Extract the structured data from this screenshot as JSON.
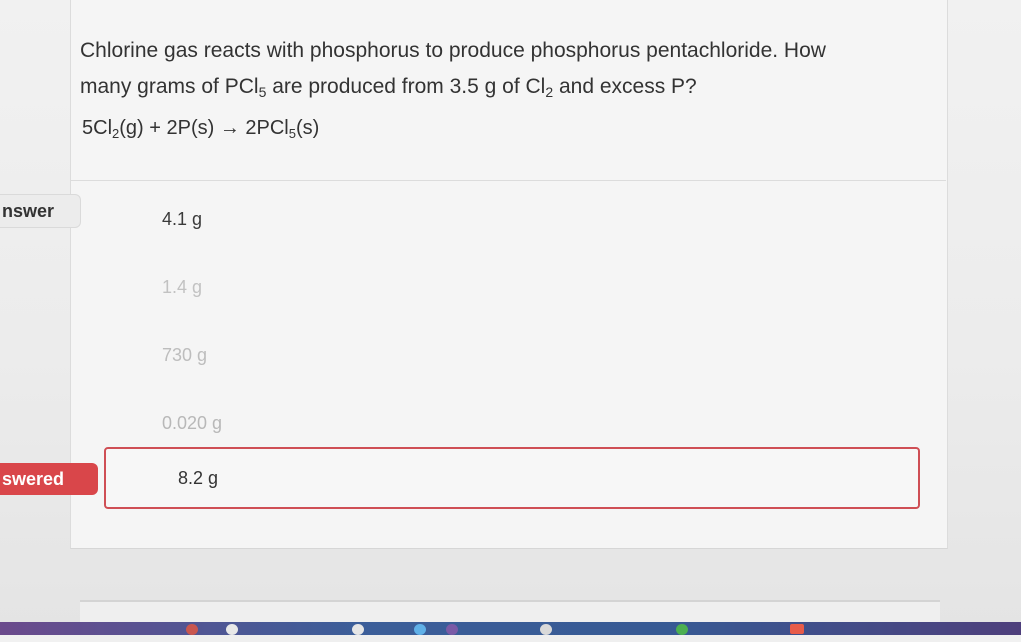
{
  "question": {
    "line1": "Chlorine gas reacts with phosphorus to produce phosphorus pentachloride. How",
    "line2_a": "many grams of PCl",
    "line2_sub1": "5",
    "line2_b": " are produced from 3.5 g of Cl",
    "line2_sub2": "2",
    "line2_c": " and excess P?",
    "equation": {
      "a": "5Cl",
      "sub1": "2",
      "b": "(g) + 2P(s) → 2PCl",
      "sub2": "5",
      "c": "(s)"
    }
  },
  "side_tabs": {
    "answer": "nswer",
    "answered": "swered"
  },
  "options": [
    {
      "label": "4.1 g"
    },
    {
      "label": "1.4 g"
    },
    {
      "label": "730 g"
    },
    {
      "label": "0.020 g"
    },
    {
      "label": "8.2 g",
      "selected": true
    }
  ],
  "colors": {
    "selected_border": "#cf4f55",
    "answered_tab": "#d9464a",
    "panel_bg": "#f5f5f5"
  },
  "taskbar_icons": [
    "app-icon",
    "app-icon",
    "app-icon",
    "app-icon",
    "app-icon",
    "app-icon",
    "app-icon",
    "app-icon"
  ]
}
